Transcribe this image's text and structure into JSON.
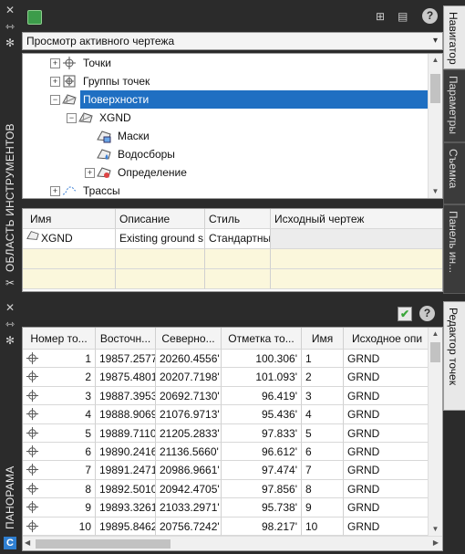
{
  "toolspace": {
    "title": "ОБЛАСТЬ ИНСТРУМЕНТОВ",
    "view_selector": "Просмотр активного чертежа",
    "tabs": [
      "Навигатор",
      "Параметры",
      "Съемка",
      "Панель ин..."
    ],
    "tree": [
      {
        "label": "Точки",
        "level": 1,
        "expander": "+",
        "icon": "point-icon"
      },
      {
        "label": "Группы точек",
        "level": 1,
        "expander": "+",
        "icon": "point-group-icon"
      },
      {
        "label": "Поверхности",
        "level": 1,
        "expander": "-",
        "icon": "surface-icon",
        "selected": true
      },
      {
        "label": "XGND",
        "level": 2,
        "expander": "-",
        "icon": "surface-icon"
      },
      {
        "label": "Маски",
        "level": 3,
        "expander": "",
        "icon": "mask-icon"
      },
      {
        "label": "Водосборы",
        "level": 3,
        "expander": "",
        "icon": "watershed-icon"
      },
      {
        "label": "Определение",
        "level": 3,
        "expander": "+",
        "icon": "definition-icon"
      },
      {
        "label": "Трассы",
        "level": 1,
        "expander": "+",
        "icon": "alignment-icon"
      }
    ],
    "list": {
      "columns": [
        "Имя",
        "Описание",
        "Стиль",
        "Исходный чертеж"
      ],
      "rows": [
        [
          "XGND",
          "Existing ground s",
          "Стандартны",
          ""
        ]
      ]
    }
  },
  "panorama": {
    "title": "ПАНОРАМА",
    "tab": "Редактор точек",
    "columns": [
      "Номер то...",
      "Восточн...",
      "Северно...",
      "Отметка то...",
      "Имя",
      "Исходное опи"
    ],
    "rows": [
      [
        "1",
        "19857.2577'",
        "20260.4556'",
        "100.306'",
        "1",
        "GRND"
      ],
      [
        "2",
        "19875.4801'",
        "20207.7198'",
        "101.093'",
        "2",
        "GRND"
      ],
      [
        "3",
        "19887.3953'",
        "20692.7130'",
        "96.419'",
        "3",
        "GRND"
      ],
      [
        "4",
        "19888.9069'",
        "21076.9713'",
        "95.436'",
        "4",
        "GRND"
      ],
      [
        "5",
        "19889.7110'",
        "21205.2833'",
        "97.833'",
        "5",
        "GRND"
      ],
      [
        "6",
        "19890.2416'",
        "21136.5660'",
        "96.612'",
        "6",
        "GRND"
      ],
      [
        "7",
        "19891.2471'",
        "20986.9661'",
        "97.474'",
        "7",
        "GRND"
      ],
      [
        "8",
        "19892.5010'",
        "20942.4705'",
        "97.856'",
        "8",
        "GRND"
      ],
      [
        "9",
        "19893.3261'",
        "21033.2971'",
        "95.738'",
        "9",
        "GRND"
      ],
      [
        "10",
        "19895.8462'",
        "20756.7242'",
        "98.217'",
        "10",
        "GRND"
      ]
    ]
  },
  "colors": {
    "selection": "#1f6fc2",
    "panel_dark": "#2b2b2b",
    "empty_row": "#fbf7dc",
    "check": "#3aa63a"
  }
}
